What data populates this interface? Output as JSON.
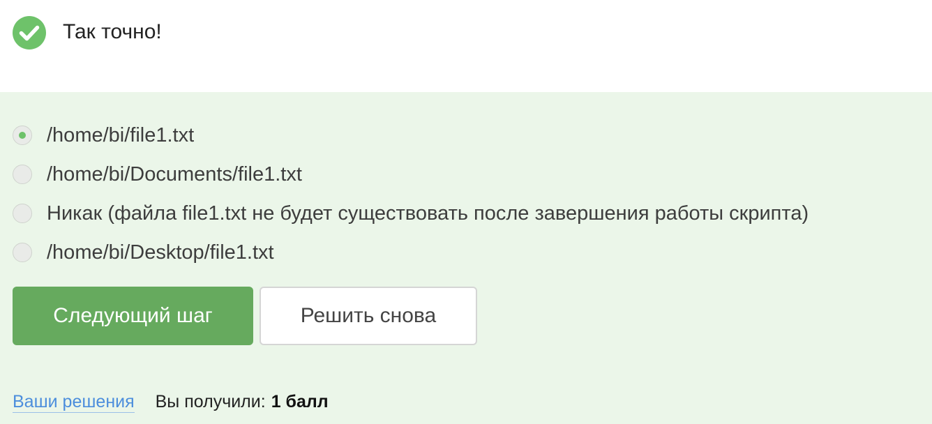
{
  "result": {
    "icon": "check-circle-icon",
    "icon_color": "#6ec26a",
    "message": "Так точно!"
  },
  "quiz": {
    "options": [
      {
        "label": "/home/bi/file1.txt",
        "checked": true
      },
      {
        "label": "/home/bi/Documents/file1.txt",
        "checked": false
      },
      {
        "label": "Никак (файла file1.txt не будет существовать после завершения работы скрипта)",
        "checked": false
      },
      {
        "label": "/home/bi/Desktop/file1.txt",
        "checked": false
      }
    ],
    "panel_color": "#ebf6e9"
  },
  "actions": {
    "next_label": "Следующий шаг",
    "retry_label": "Решить снова",
    "primary_color": "#66aa5e"
  },
  "footer": {
    "solutions_link": "Ваши решения",
    "score_label": "Вы получили:",
    "score_value": "1 балл",
    "link_color": "#4c8edc"
  }
}
